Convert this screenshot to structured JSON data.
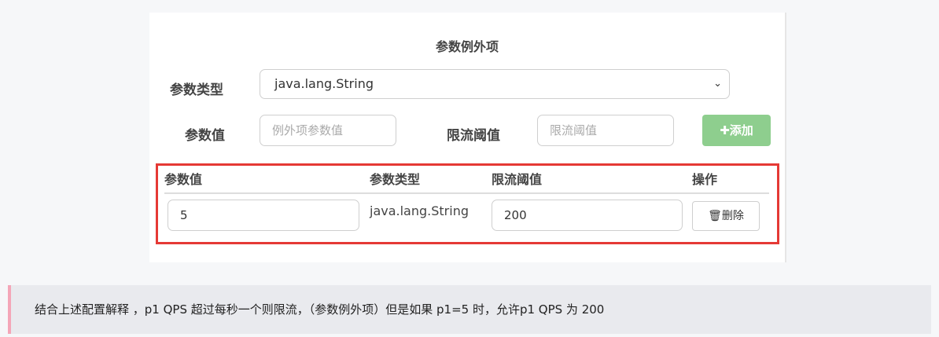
{
  "form": {
    "title": "参数例外项",
    "param_type_label": "参数类型",
    "param_type_value": "java.lang.String",
    "param_value_label": "参数值",
    "param_value_placeholder": "例外项参数值",
    "threshold_label": "限流阈值",
    "threshold_placeholder": "限流阈值",
    "add_button": "添加",
    "add_icon": "plus-icon",
    "add_button_color": "#8ece8e"
  },
  "table": {
    "headers": [
      "参数值",
      "参数类型",
      "限流阈值",
      "操作"
    ],
    "rows": [
      {
        "param_value": "5",
        "param_type": "java.lang.String",
        "threshold": "200",
        "action_label": "删除",
        "action_icon": "trash-icon"
      }
    ],
    "highlight_color": "#e53935"
  },
  "note": {
    "text": "结合上述配置解释 ，p1 QPS 超过每秒一个则限流，（参数例外项）但是如果 p1=5 时，允许p1 QPS 为 200",
    "accent_color": "#f4a6b8"
  }
}
